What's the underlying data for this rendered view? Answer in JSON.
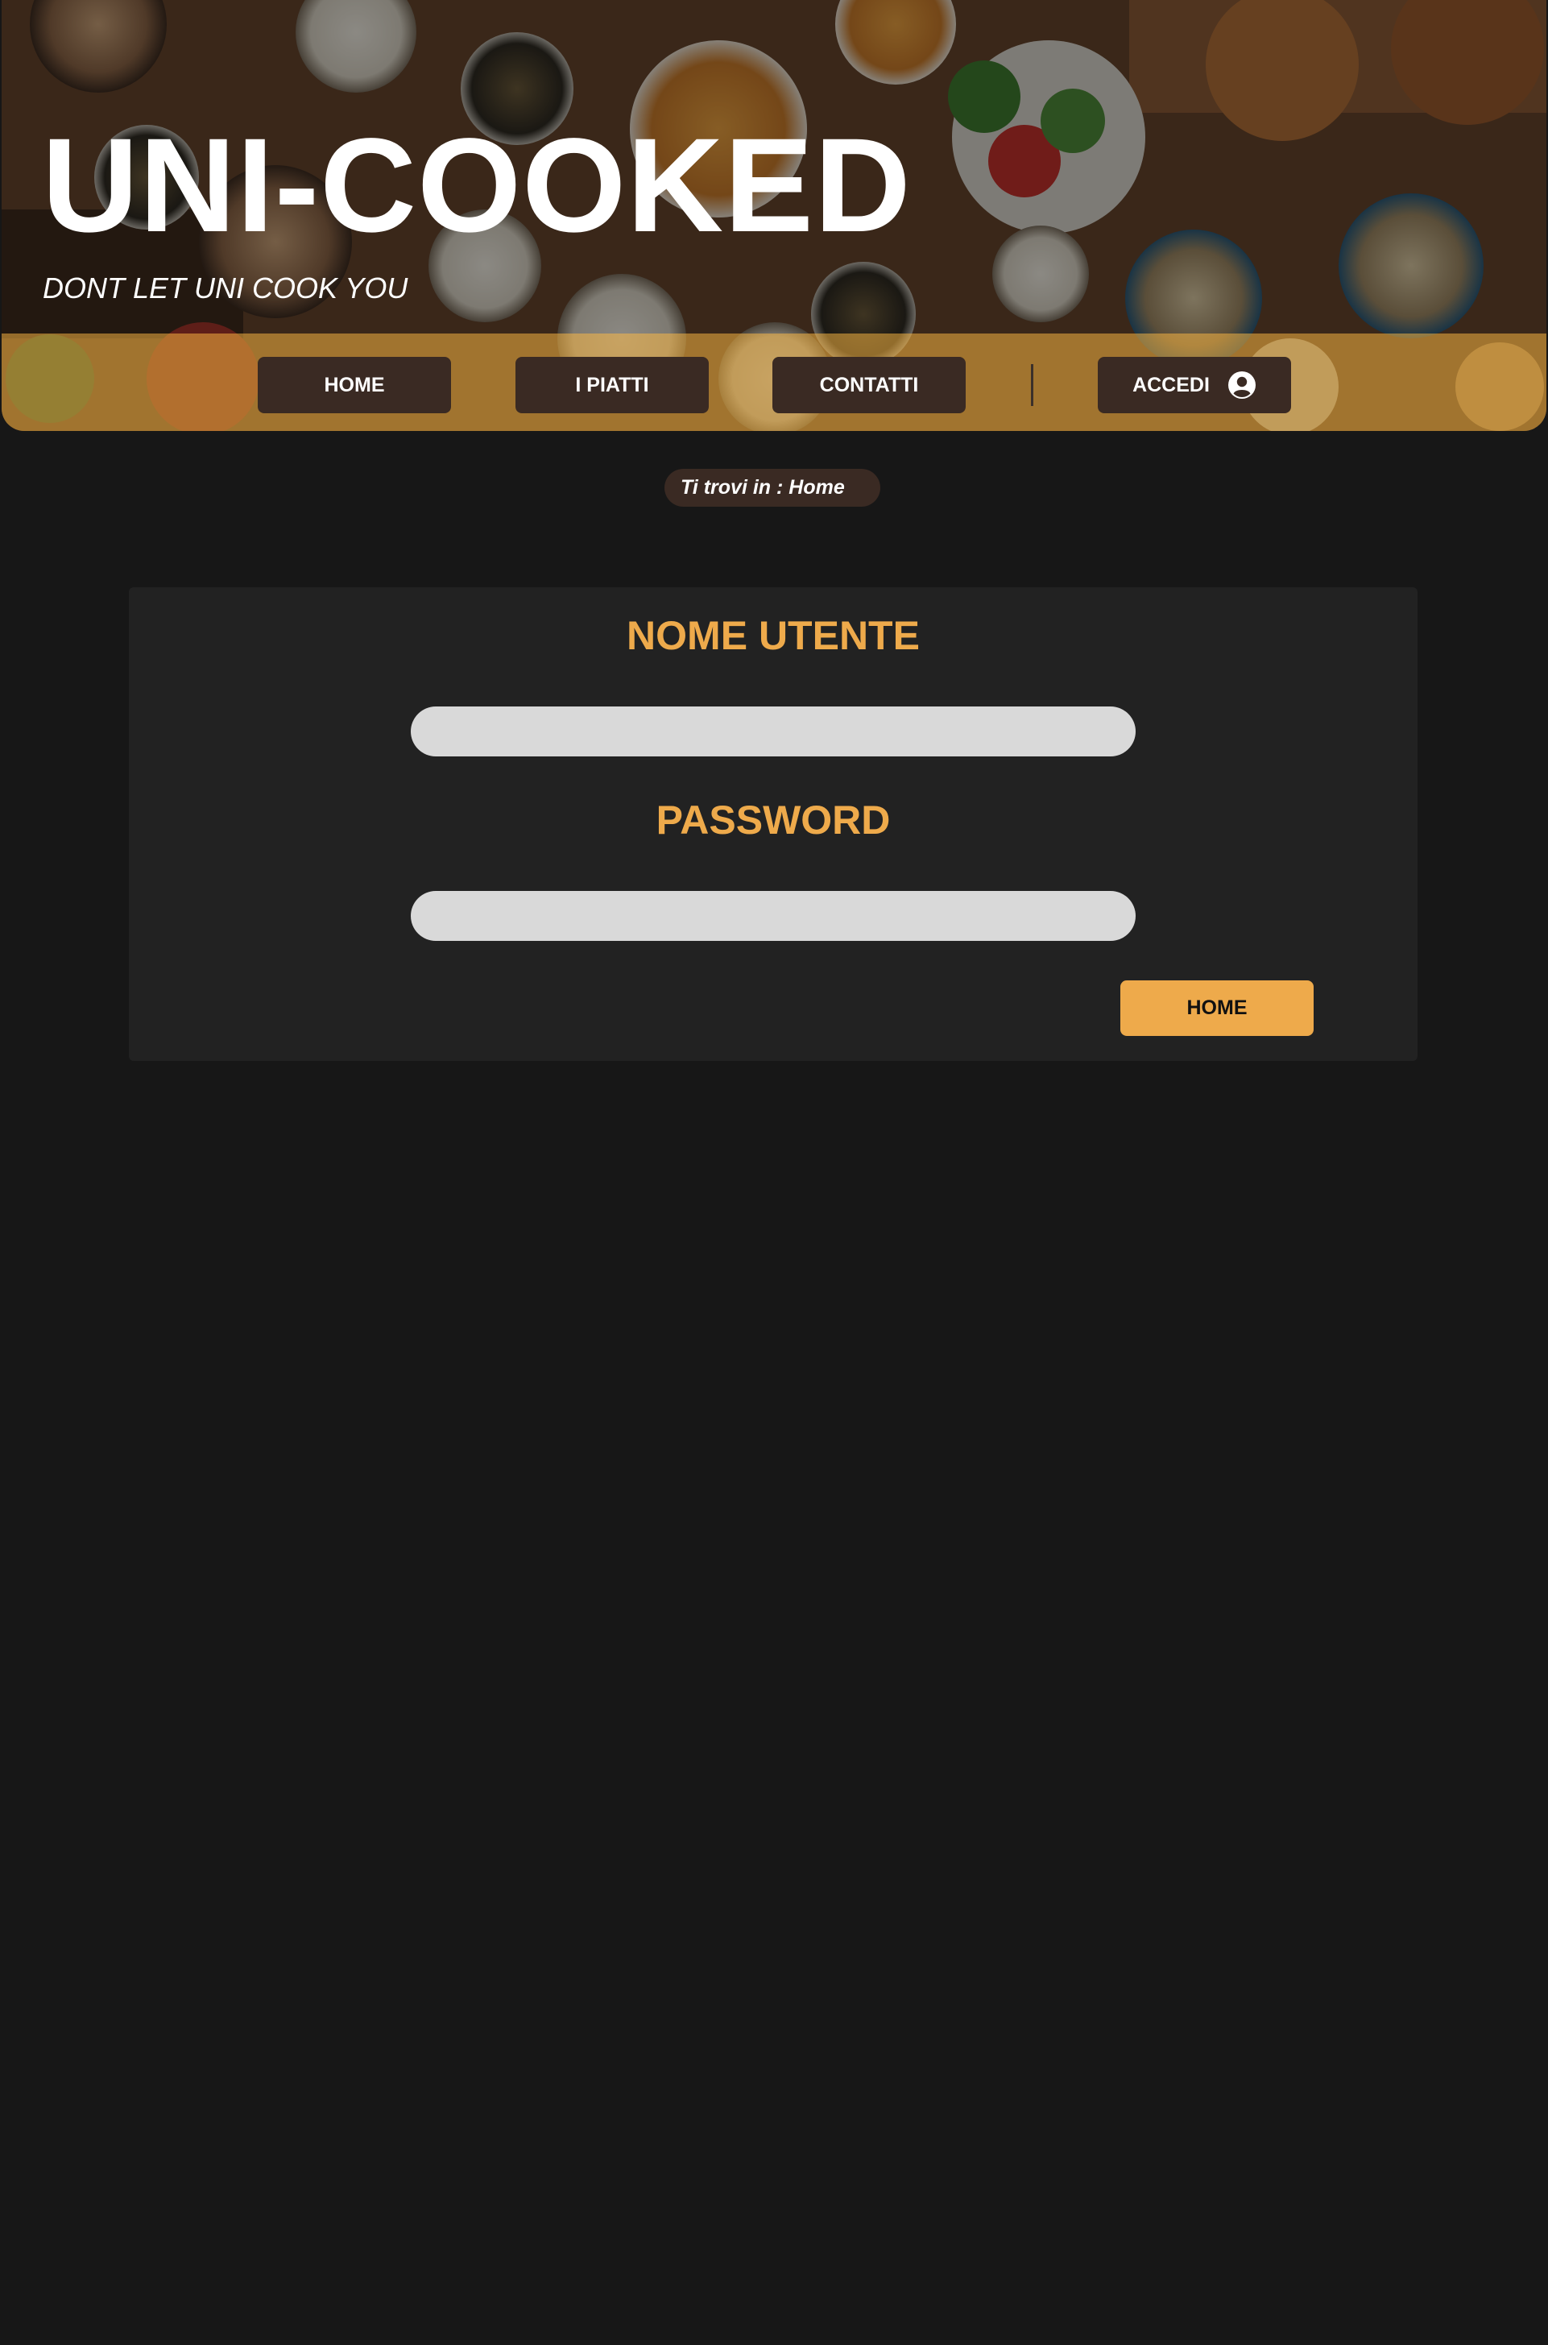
{
  "header": {
    "title": "UNI-COOKED",
    "tagline": "DONT LET UNI COOK YOU"
  },
  "nav": {
    "home_label": "HOME",
    "dishes_label": "I PIATTI",
    "contacts_label": "CONTATTI",
    "login_label": "ACCEDI",
    "login_icon": "user-circle-icon"
  },
  "breadcrumb": {
    "text": "Ti trovi in : Home"
  },
  "login_form": {
    "username_label": "NOME UTENTE",
    "username_value": "",
    "password_label": "PASSWORD",
    "password_value": "",
    "submit_label": "HOME"
  },
  "colors": {
    "page_background": "#171717",
    "card_background": "#222222",
    "accent": "#eeaa4b",
    "nav_button": "#3a2a23",
    "input_background": "#d9d9d9",
    "header_band": "#b88630"
  }
}
